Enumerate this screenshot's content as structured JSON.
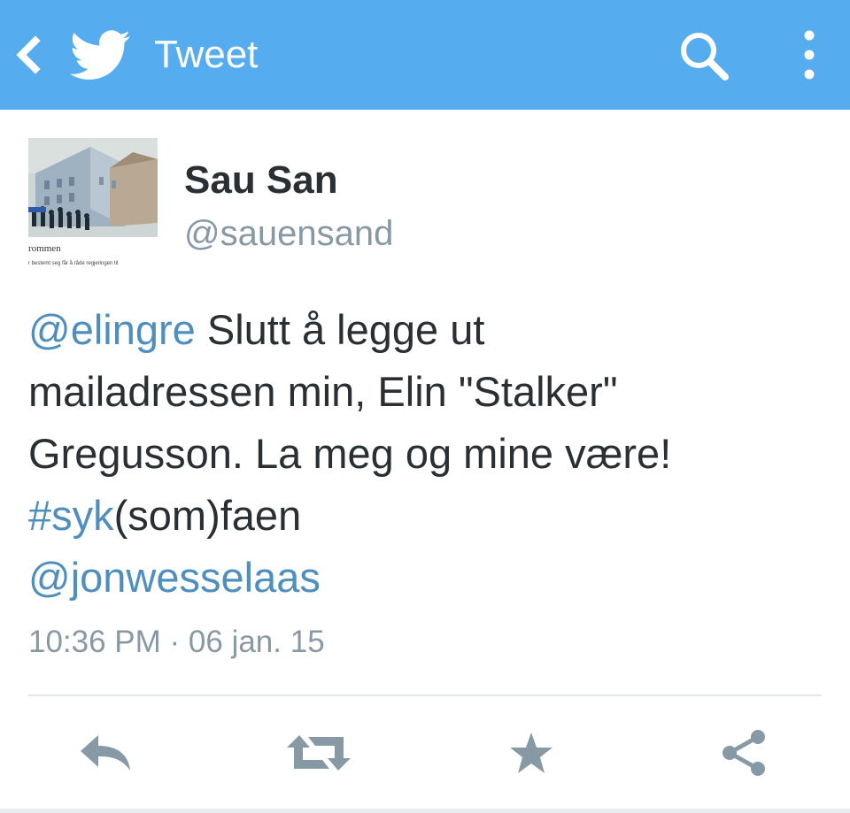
{
  "app": {
    "accent_color": "#55acee"
  },
  "topbar": {
    "title": "Tweet",
    "back_icon": "chevron-left-icon",
    "logo_icon": "twitter-bird-icon",
    "search_icon": "search-icon",
    "menu_icon": "more-vertical-icon"
  },
  "tweet": {
    "avatar_caption": "rommen",
    "avatar_subcaption": "r bestemt seg får å råde regjeringen til",
    "display_name": "Sau San",
    "handle": "@sauensand",
    "text": {
      "mention1": "@elingre",
      "line1_rest": " Slutt å legge ut",
      "line2": "mailadressen min, Elin \"Stalker\"",
      "line3": "Gregusson. La meg og mine være!",
      "hashtag": "#syk",
      "hashtag_rest": "(som)faen",
      "mention2": "@jonwesselaas"
    },
    "timestamp": "10:36 PM · 06 jan. 15"
  },
  "actions": [
    {
      "name": "reply",
      "icon": "reply-icon"
    },
    {
      "name": "retweet",
      "icon": "retweet-icon"
    },
    {
      "name": "favorite",
      "icon": "star-icon"
    },
    {
      "name": "share",
      "icon": "share-icon"
    }
  ]
}
